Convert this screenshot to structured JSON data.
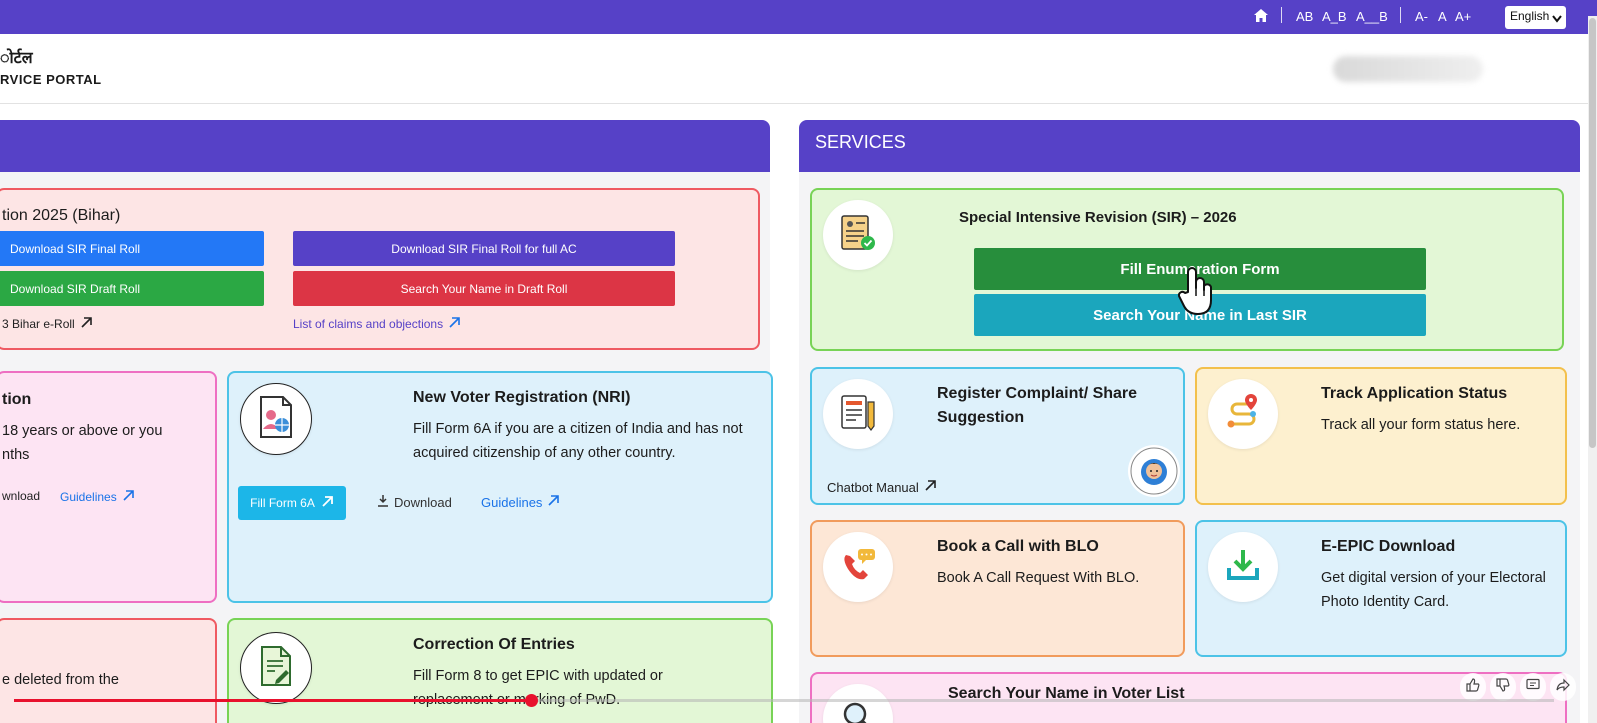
{
  "topbar": {
    "text_sizes": [
      "AB",
      "A_B",
      "A__B"
    ],
    "font_sizes": [
      "A-",
      "A",
      "A+"
    ],
    "language": "English"
  },
  "header": {
    "logo_line1": "ोर्टल",
    "logo_line2": "RVICE PORTAL"
  },
  "left_panel": {
    "sir_card": {
      "title": "tion 2025 (Bihar)",
      "buttons": [
        "Download SIR Final Roll",
        "Download SIR Final Roll for full AC",
        "Download SIR Draft Roll",
        "Search Your Name in Draft Roll"
      ],
      "link1": "3 Bihar e-Roll",
      "link2": "List of claims and objections"
    },
    "reg_card": {
      "title": "tion",
      "desc_line1": "18 years or above or you",
      "desc_line2": "nths",
      "download": "wnload",
      "guidelines": "Guidelines"
    },
    "nri_card": {
      "title": "New Voter Registration (NRI)",
      "desc": "Fill Form 6A if you are a citizen of India and has not acquired citizenship of any other country.",
      "button": "Fill Form 6A",
      "download": "Download",
      "guidelines": "Guidelines"
    },
    "delete_card": {
      "desc": "e deleted from the"
    },
    "correction_card": {
      "title": "Correction Of Entries",
      "desc": "Fill Form 8 to get EPIC with updated or replacement or marking of PwD."
    }
  },
  "services": {
    "title": "SERVICES",
    "sir2026": {
      "title": "Special Intensive Revision (SIR) – 2026",
      "btn_fill": "Fill Enumeration Form",
      "btn_search": "Search Your Name in Last SIR"
    },
    "complaint": {
      "title": "Register Complaint/ Share Suggestion",
      "link": "Chatbot Manual"
    },
    "track": {
      "title": "Track Application Status",
      "desc": "Track all your form status here."
    },
    "blo": {
      "title": "Book a Call with BLO",
      "desc": "Book A Call Request With BLO."
    },
    "epic": {
      "title": "E-EPIC Download",
      "desc": "Get digital version of your Electoral Photo Identity Card."
    },
    "search_voter": {
      "title": "Search Your Name in Voter List"
    }
  },
  "video": {
    "progress": 0.336
  },
  "colors": {
    "brand": "#5641c7",
    "btn_blue": "#2378f6",
    "btn_purple": "#5641c7",
    "btn_green": "#2ba844",
    "btn_red": "#dc3545",
    "btn_darkgreen": "#278e3c",
    "btn_teal": "#1ba6bd",
    "btn_cyan": "#1cb6e8",
    "link_blue": "#1a73e8",
    "link_purple": "#5641c7"
  }
}
